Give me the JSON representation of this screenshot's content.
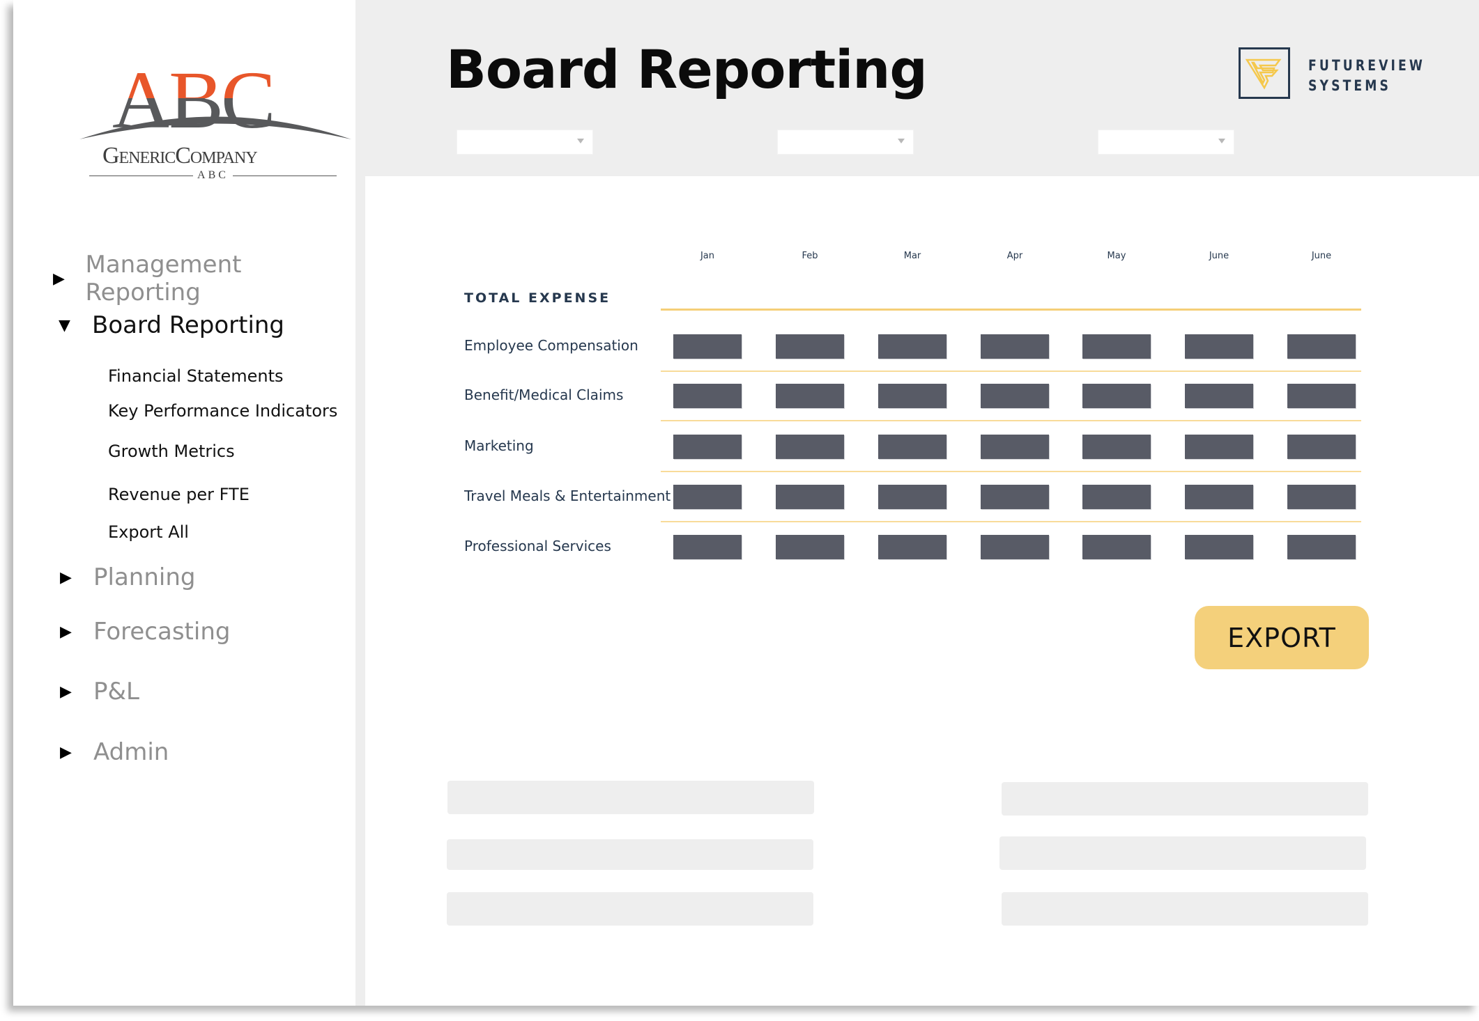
{
  "company_logo": {
    "letters": [
      "A",
      "B",
      "C"
    ],
    "name": "GenericCompany",
    "tagline": "ABC"
  },
  "brand_logo": {
    "line1": "FUTUREVIEW",
    "line2": "SYSTEMS",
    "accent_color": "#f5c84c",
    "frame_color": "#26384e"
  },
  "sidebar": {
    "items": [
      {
        "label": "Management Reporting",
        "expanded": false,
        "active": false
      },
      {
        "label": "Board Reporting",
        "expanded": true,
        "active": true,
        "children": [
          "Financial Statements",
          "Key Performance Indicators",
          "Growth Metrics",
          "Revenue per FTE",
          "Export All"
        ]
      },
      {
        "label": "Planning",
        "expanded": false,
        "active": false
      },
      {
        "label": "Forecasting",
        "expanded": false,
        "active": false
      },
      {
        "label": "P&L",
        "expanded": false,
        "active": false
      },
      {
        "label": "Admin",
        "expanded": false,
        "active": false
      }
    ]
  },
  "header": {
    "title": "Board Reporting",
    "filters": [
      {
        "selected": ""
      },
      {
        "selected": ""
      },
      {
        "selected": ""
      }
    ]
  },
  "table": {
    "section_title": "TOTAL EXPENSE",
    "months": [
      "Jan",
      "Feb",
      "Mar",
      "Apr",
      "May",
      "June",
      "June"
    ],
    "rows": [
      "Employee Compensation",
      "Benefit/Medical Claims",
      "Marketing",
      "Travel Meals & Entertainment",
      "Professional Services"
    ]
  },
  "actions": {
    "export_label": "EXPORT"
  },
  "colors": {
    "accent": "#f4d07b",
    "divider": "#f5cf77",
    "cell": "#585b66",
    "header_bg": "#eeeeee",
    "text_dark": "#26384e",
    "logo_orange": "#e8562a"
  }
}
